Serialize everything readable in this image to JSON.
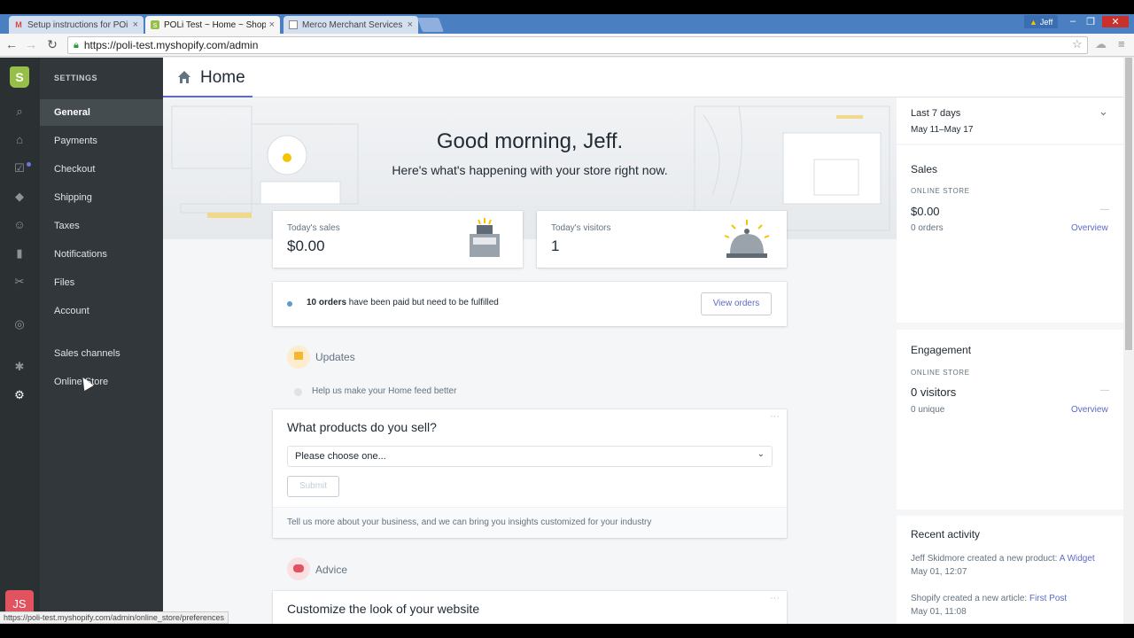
{
  "browser": {
    "tabs": [
      {
        "title": "Setup instructions for POi",
        "favicon": "gmail-icon",
        "active": false
      },
      {
        "title": "POLi Test ~ Home ~ Shop",
        "favicon": "shopify-icon",
        "active": true
      },
      {
        "title": "Merco Merchant Services",
        "favicon": "page-icon",
        "active": false
      }
    ],
    "user": "Jeff",
    "url": "https://poli-test.myshopify.com/admin",
    "status_url": "https://poli-test.myshopify.com/admin/online_store/preferences"
  },
  "settings": {
    "heading": "SETTINGS",
    "items": [
      {
        "label": "General",
        "active": true
      },
      {
        "label": "Payments"
      },
      {
        "label": "Checkout"
      },
      {
        "label": "Shipping"
      },
      {
        "label": "Taxes"
      },
      {
        "label": "Notifications"
      },
      {
        "label": "Files"
      },
      {
        "label": "Account"
      },
      {
        "label": "Sales channels"
      },
      {
        "label": "Online Store"
      }
    ]
  },
  "avatar": {
    "initials": "JS"
  },
  "header": {
    "title": "Home"
  },
  "hero": {
    "greeting": "Good morning, Jeff.",
    "subtitle": "Here's what's happening with your store right now."
  },
  "stats": {
    "sales": {
      "label": "Today's sales",
      "value": "$0.00"
    },
    "visitors": {
      "label": "Today's visitors",
      "value": "1"
    }
  },
  "orders_notice": {
    "count": "10 orders",
    "text": " have been paid but need to be fulfilled",
    "button": "View orders"
  },
  "updates": {
    "title": "Updates",
    "item": "Help us make your Home feed better"
  },
  "products_card": {
    "question": "What products do you sell?",
    "select_value": "Please choose one...",
    "submit": "Submit",
    "footer": "Tell us more about your business, and we can bring you insights customized for your industry"
  },
  "advice": {
    "title": "Advice",
    "card_title": "Customize the look of your website"
  },
  "right": {
    "range_label": "Last 7 days",
    "range_dates": "May 11–May 17",
    "sales": {
      "title": "Sales",
      "channel": "ONLINE STORE",
      "value": "$0.00",
      "sub": "0 orders",
      "dash": "—",
      "link": "Overview"
    },
    "engagement": {
      "title": "Engagement",
      "channel": "ONLINE STORE",
      "value": "0 visitors",
      "sub": "0 unique",
      "dash": "—",
      "link": "Overview"
    },
    "activity": {
      "title": "Recent activity",
      "items": [
        {
          "text": "Jeff Skidmore created a new product: ",
          "link": "A Widget",
          "time": "May 01, 12:07"
        },
        {
          "text": "Shopify created a new article: ",
          "link": "First Post",
          "time": "May 01, 11:08"
        }
      ]
    }
  },
  "colors": {
    "accent": "#5c6ac4",
    "sidebar": "#31373a",
    "rail": "#2b3033",
    "shopify_green": "#95bf47",
    "avatar": "#e0535f"
  }
}
